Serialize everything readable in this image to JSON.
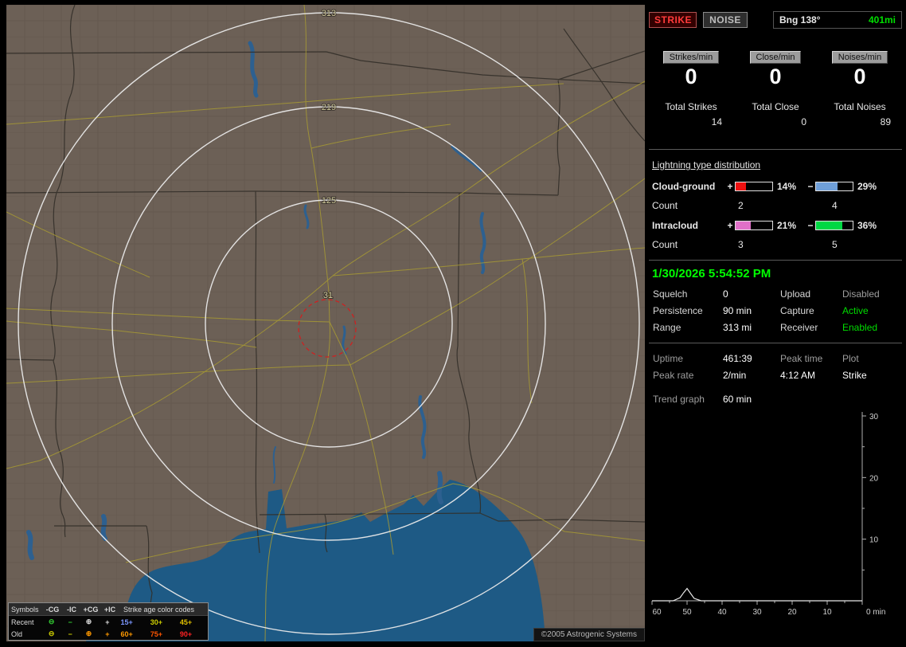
{
  "colors": {
    "status_green": "#00dd00",
    "timestamp_green": "#00ff00",
    "strike_red": "#ff3b3b",
    "map_land": "#6c6056",
    "water_blue": "#1e5a85",
    "road_yellow": "#a79a33",
    "ring_white": "#eaeaea",
    "alarm_red": "#cc2222"
  },
  "map": {
    "ring_labels": [
      "313",
      "219",
      "125",
      "31"
    ],
    "copyright": "©2005 Astrogenic Systems",
    "legend": {
      "symbols_header": "Symbols",
      "col_headers": [
        "-CG",
        "-IC",
        "+CG",
        "+IC"
      ],
      "age_header": "Strike age color codes",
      "rows": [
        {
          "label": "Recent",
          "icons": [
            {
              "glyph": "⊖",
              "color": "#33cc33"
            },
            {
              "glyph": "−",
              "color": "#33cc33"
            },
            {
              "glyph": "⊕",
              "color": "#d8d8d8"
            },
            {
              "glyph": "+",
              "color": "#d8d8d8"
            }
          ],
          "ages": [
            {
              "text": "15+",
              "color": "#7b96ff"
            },
            {
              "text": "30+",
              "color": "#cfcf00"
            },
            {
              "text": "45+",
              "color": "#e0c000"
            }
          ]
        },
        {
          "label": "Old",
          "icons": [
            {
              "glyph": "⊖",
              "color": "#cfcf00"
            },
            {
              "glyph": "−",
              "color": "#cfcf00"
            },
            {
              "glyph": "⊕",
              "color": "#ff9900"
            },
            {
              "glyph": "+",
              "color": "#ff9900"
            }
          ],
          "ages": [
            {
              "text": "60+",
              "color": "#ff9900"
            },
            {
              "text": "75+",
              "color": "#ff5500"
            },
            {
              "text": "90+",
              "color": "#ff2222"
            }
          ]
        }
      ]
    }
  },
  "panel": {
    "strike_btn": "STRIKE",
    "noise_btn": "NOISE",
    "bearing_label": "Bng 138°",
    "bearing_range": "401mi",
    "rates": [
      {
        "label": "Strikes/min",
        "value": "0"
      },
      {
        "label": "Close/min",
        "value": "0"
      },
      {
        "label": "Noises/min",
        "value": "0"
      }
    ],
    "totals": [
      {
        "label": "Total Strikes",
        "value": "14"
      },
      {
        "label": "Total Close",
        "value": "0"
      },
      {
        "label": "Total Noises",
        "value": "89"
      }
    ],
    "distribution": {
      "title": "Lightning type distribution",
      "count_label": "Count",
      "rows": [
        {
          "label": "Cloud-ground",
          "pos_sign": "+",
          "pos_pct": "14%",
          "pos_fill": 28,
          "pos_color": "#ee1111",
          "neg_sign": "−",
          "neg_pct": "29%",
          "neg_fill": 58,
          "neg_color": "#6f9fd8",
          "pos_count": "2",
          "neg_count": "4"
        },
        {
          "label": "Intracloud",
          "pos_sign": "+",
          "pos_pct": "21%",
          "pos_fill": 42,
          "pos_color": "#e070c8",
          "neg_sign": "−",
          "neg_pct": "36%",
          "neg_fill": 72,
          "neg_color": "#00d844",
          "pos_count": "3",
          "neg_count": "5"
        }
      ]
    },
    "timestamp": "1/30/2026 5:54:52 PM",
    "settings": {
      "rows": [
        {
          "l1": "Squelch",
          "v1": "0",
          "l2": "Upload",
          "v2": "Disabled",
          "v2_color": "#9e9e9e"
        },
        {
          "l1": "Persistence",
          "v1": "90 min",
          "l2": "Capture",
          "v2": "Active",
          "v2_color": "#00dd00"
        },
        {
          "l1": "Range",
          "v1": "313 mi",
          "l2": "Receiver",
          "v2": "Enabled",
          "v2_color": "#00dd00"
        }
      ]
    },
    "stats_cells": [
      {
        "t": "Uptime"
      },
      {
        "t": "461:39"
      },
      {
        "t": "Peak time"
      },
      {
        "t": "Plot"
      },
      {
        "t": "Peak rate"
      },
      {
        "t": "2/min"
      },
      {
        "t": "4:12 AM"
      },
      {
        "t": "Strike"
      }
    ],
    "trend_label": "Trend graph",
    "trend_value": "60 min"
  },
  "chart_data": {
    "type": "line",
    "title": "Trend graph — strikes per minute, last 60 min",
    "x_unit": "min",
    "xlim": [
      60,
      0
    ],
    "ylim": [
      0,
      30
    ],
    "x_ticks": [
      60,
      50,
      40,
      30,
      20,
      10,
      0
    ],
    "y_ticks": [
      10,
      20,
      30
    ],
    "legend_position": "none",
    "grid": false,
    "series": [
      {
        "name": "Strike",
        "points": [
          [
            60,
            0
          ],
          [
            54,
            0
          ],
          [
            52,
            0.5
          ],
          [
            51,
            1.3
          ],
          [
            50,
            2
          ],
          [
            49,
            1.2
          ],
          [
            48,
            0.4
          ],
          [
            46,
            0
          ],
          [
            0,
            0
          ]
        ]
      }
    ],
    "line_color": "#e8e8e8"
  }
}
